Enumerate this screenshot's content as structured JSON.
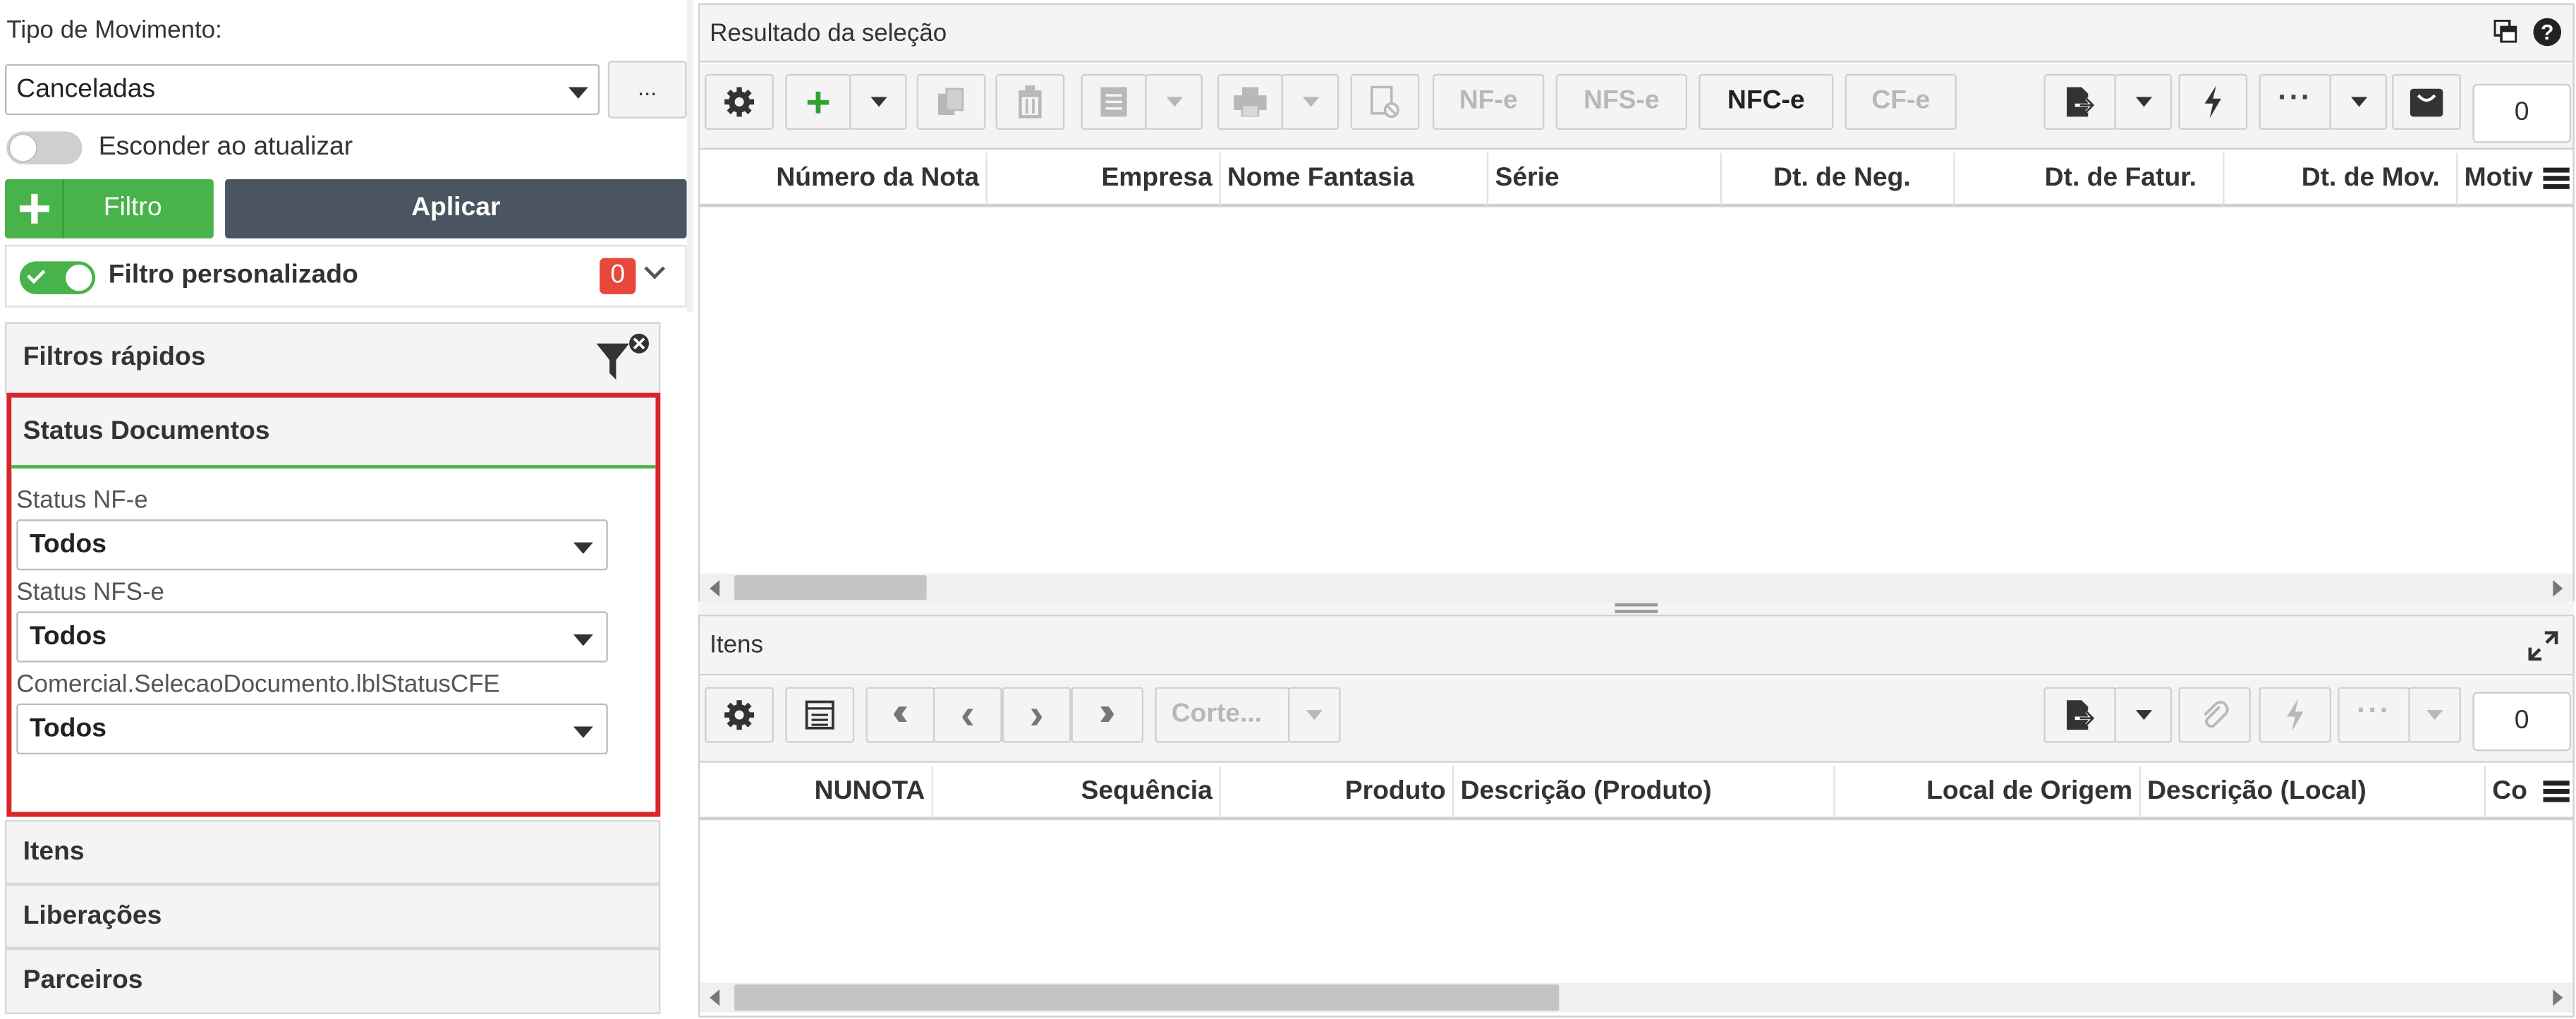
{
  "left": {
    "tipo_label": "Tipo de Movimento:",
    "tipo_value": "Canceladas",
    "more_label": "...",
    "hide_label": "Esconder ao atualizar",
    "filtro_label": "Filtro",
    "aplicar_label": "Aplicar",
    "filtro_pers_label": "Filtro personalizado",
    "filtro_pers_count": "0",
    "filtros_rapidos_label": "Filtros rápidos",
    "status_title": "Status Documentos",
    "status_nfe_label": "Status NF-e",
    "status_nfe_value": "Todos",
    "status_nfse_label": "Status NFS-e",
    "status_nfse_value": "Todos",
    "status_cfe_label": "Comercial.SelecaoDocumento.lblStatusCFE",
    "status_cfe_value": "Todos",
    "sections": [
      "Itens",
      "Liberações",
      "Parceiros"
    ]
  },
  "top_panel": {
    "title": "Resultado da seleção",
    "toolbar": {
      "nfe": "NF-e",
      "nfse": "NFS-e",
      "nfce": "NFC-e",
      "cfe": "CF-e",
      "count": "0"
    },
    "columns": [
      "Número da Nota",
      "Empresa",
      "Nome Fantasia",
      "Série",
      "Dt. de Neg.",
      "Dt. de Fatur.",
      "Dt. de Mov.",
      "Motiv"
    ]
  },
  "bottom_panel": {
    "title": "Itens",
    "toolbar": {
      "corte": "Corte...",
      "count": "0"
    },
    "columns": [
      "NUNOTA",
      "Sequência",
      "Produto",
      "Descrição (Produto)",
      "Local de Origem",
      "Descrição (Local)",
      "Co"
    ]
  },
  "colors": {
    "accent_green": "#48b34a",
    "dark_button": "#4b5562",
    "badge_red": "#e8473b",
    "highlight_red": "#d9262b"
  }
}
